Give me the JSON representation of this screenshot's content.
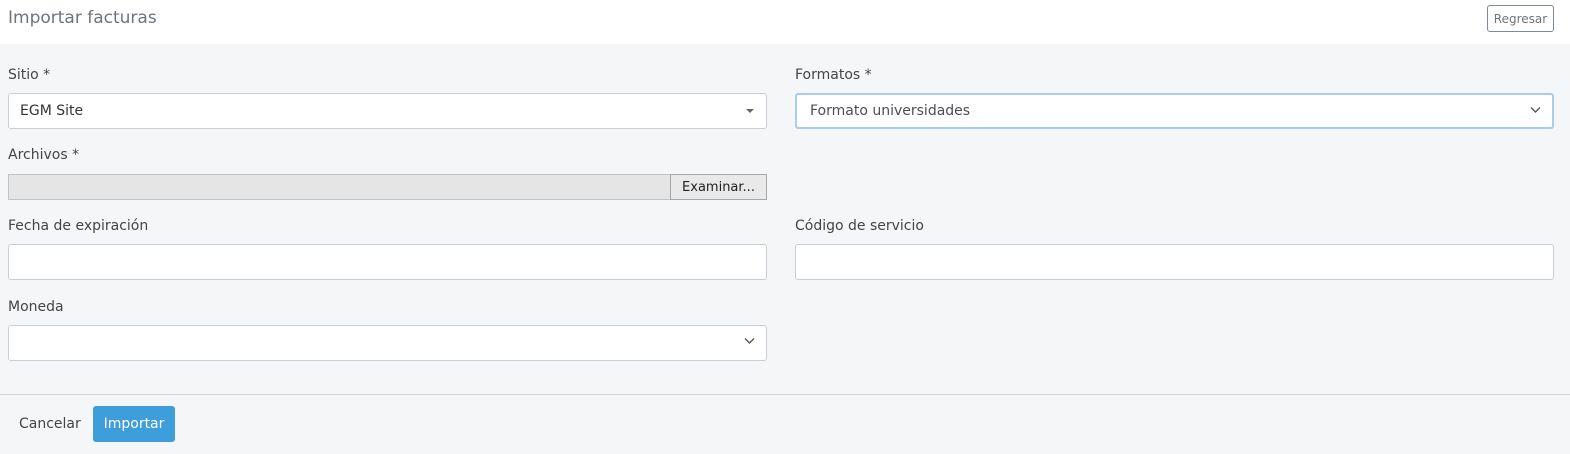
{
  "header": {
    "title": "Importar facturas",
    "back_label": "Regresar"
  },
  "form": {
    "site": {
      "label": "Sitio *",
      "value": "EGM Site"
    },
    "format": {
      "label": "Formatos *",
      "value": "Formato universidades"
    },
    "files": {
      "label": "Archivos *",
      "button_label": "Examinar..."
    },
    "expiration": {
      "label": "Fecha de expiración",
      "value": ""
    },
    "service_code": {
      "label": "Código de servicio",
      "value": ""
    },
    "currency": {
      "label": "Moneda",
      "value": ""
    }
  },
  "footer": {
    "cancel_label": "Cancelar",
    "import_label": "Importar"
  },
  "colors": {
    "primary": "#3e9ddb",
    "focus_border": "#a7cdea"
  },
  "icons": {
    "site_select": "caret-down-icon",
    "format_select": "chevron-down-icon",
    "currency_select": "chevron-down-icon"
  }
}
